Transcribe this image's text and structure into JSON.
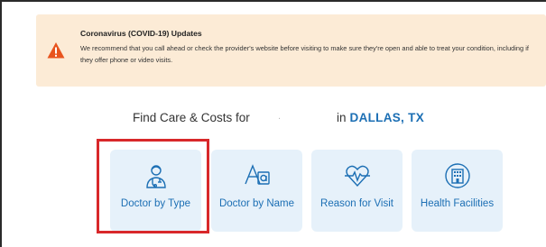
{
  "banner": {
    "title": "Coronavirus (COVID-19) Updates",
    "message": "We recommend that you call ahead or check the provider's website before visiting to make sure they're open and able to treat your condition, including if they offer phone or video visits.",
    "icon": "warning-icon",
    "accent_color": "#e8541e"
  },
  "search": {
    "find_label": "Find Care & Costs for",
    "care_type_placeholder": ".",
    "in_label": "in",
    "location": "DALLAS, TX"
  },
  "tiles": [
    {
      "label": "Doctor by Type",
      "icon": "doctor-icon"
    },
    {
      "label": "Doctor by Name",
      "icon": "name-search-icon"
    },
    {
      "label": "Reason for Visit",
      "icon": "heartbeat-icon"
    },
    {
      "label": "Health Facilities",
      "icon": "hospital-icon"
    }
  ],
  "colors": {
    "brand_blue": "#1c6fb4",
    "tile_bg": "#e6f1fa",
    "banner_bg": "#fcebd6",
    "highlight": "#d8282a"
  }
}
